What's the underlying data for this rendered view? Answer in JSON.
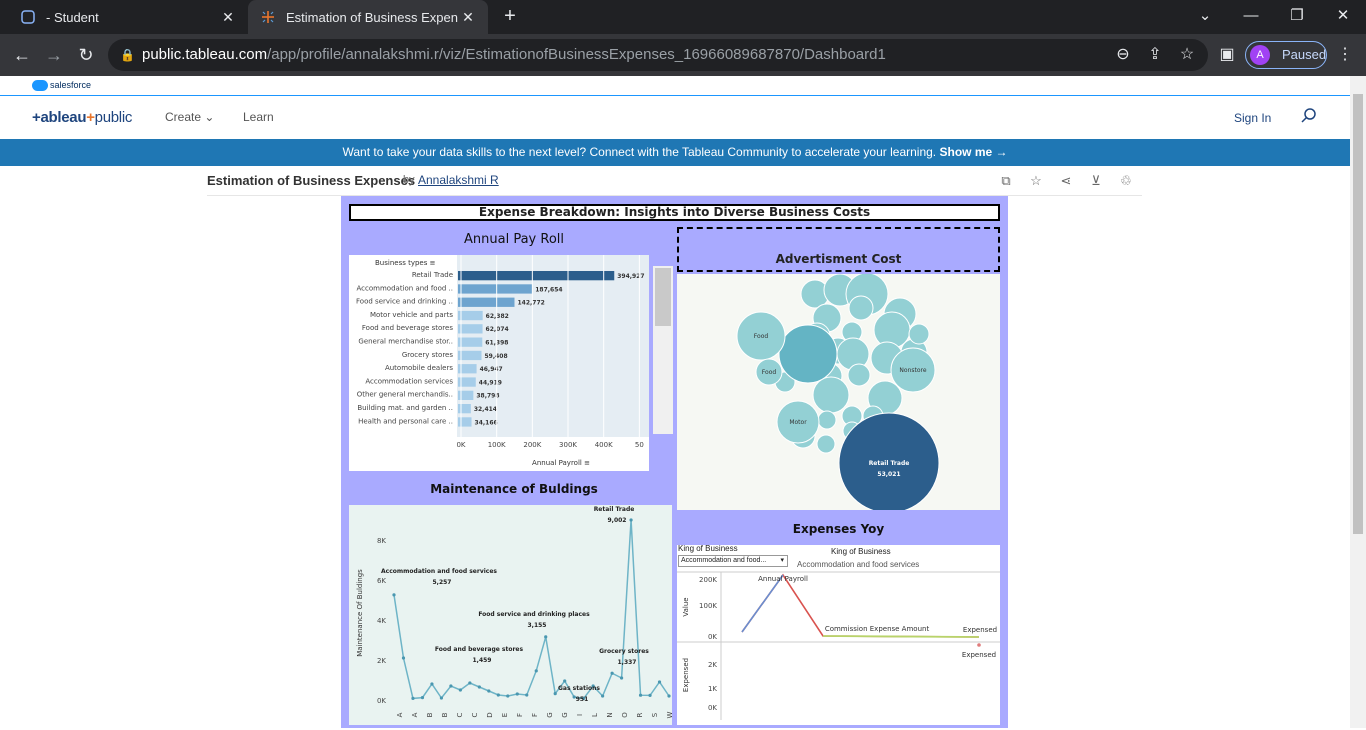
{
  "browser": {
    "tabs": [
      {
        "label": "- Student"
      },
      {
        "label": "Estimation of Business Expenses"
      }
    ],
    "url_host": "public.tableau.com",
    "url_path": "/app/profile/annalakshmi.r/viz/EstimationofBusinessExpenses_16966089687870/Dashboard1",
    "profile_initial": "A",
    "profile_label": "Paused"
  },
  "salesforce_label": "salesforce",
  "nav": {
    "logo_a": "+ableau",
    "logo_b": "+",
    "logo_c": "public",
    "create": "Create",
    "learn": "Learn",
    "signin": "Sign In"
  },
  "banner": {
    "text": "Want to take your data skills to the next level? Connect with the Tableau Community to accelerate your learning.",
    "cta": "Show me →"
  },
  "viz": {
    "title": "Estimation of Business Expenses",
    "by": "by",
    "author": "Annalakshmi R"
  },
  "dashboard": {
    "title": "Expense Breakdown: Insights into Diverse Business Costs",
    "payroll_title": "Annual Pay Roll",
    "ad_title": "Advertisment Cost",
    "maint_title": "Maintenance of Buldings",
    "yoy_title": "Expenses Yoy"
  },
  "chart_data": [
    {
      "type": "bar",
      "title": "Annual Pay Roll",
      "row_header": "Business types",
      "xlabel": "Annual Payroll",
      "xticks": [
        "0K",
        "100K",
        "200K",
        "300K",
        "400K",
        "50"
      ],
      "categories": [
        "Retail Trade",
        "Accommodation and food ..",
        "Food service and drinking ..",
        "Motor vehicle and parts",
        "Food and beverage stores",
        "General merchandise stor..",
        "Grocery stores",
        "Automobile dealers",
        "Accommodation services",
        "Other general merchandis..",
        "Building mat. and garden ..",
        "Health and personal care .."
      ],
      "values": [
        394927,
        187654,
        142772,
        62382,
        62074,
        61398,
        59408,
        46947,
        44919,
        38798,
        32414,
        34166
      ],
      "labels": [
        "394,927",
        "187,654",
        "142,772",
        "62,382",
        "62,074",
        "61,398",
        "59,408",
        "46,947",
        "44,919",
        "38,798",
        "32,414",
        "34,166"
      ],
      "xlim": [
        0,
        460000
      ]
    },
    {
      "type": "scatter",
      "title": "Advertisment Cost",
      "bubbles": [
        {
          "label": "Retail Trade",
          "value": "53,021"
        },
        {
          "label": "Food",
          "value": ""
        },
        {
          "label": "Food",
          "value": ""
        },
        {
          "label": "Nonstore",
          "value": ""
        },
        {
          "label": "Motor",
          "value": ""
        }
      ]
    },
    {
      "type": "line",
      "title": "Maintenance of Buldings",
      "ylabel": "Maintenance Of Buldings",
      "yticks": [
        "0K",
        "2K",
        "4K",
        "6K",
        "8K"
      ],
      "ylim": [
        0,
        9500
      ],
      "xticks": [
        "A",
        "A",
        "B",
        "B",
        "C",
        "C",
        "D",
        "E",
        "F",
        "F",
        "G",
        "G",
        "I",
        "L",
        "N",
        "O",
        "R",
        "S",
        "W"
      ],
      "values": [
        5257,
        2100,
        80,
        120,
        800,
        100,
        700,
        500,
        850,
        650,
        450,
        250,
        200,
        300,
        250,
        1459,
        3155,
        320,
        951,
        150,
        80,
        700,
        200,
        1337,
        1100,
        9002,
        240,
        230,
        900,
        200
      ],
      "annotations": [
        {
          "name": "Retail Trade",
          "value": "9,002"
        },
        {
          "name": "Accommodation and food services",
          "value": "5,257"
        },
        {
          "name": "Food service and drinking places",
          "value": "3,155"
        },
        {
          "name": "Food and beverage stores",
          "value": "1,459"
        },
        {
          "name": "Grocery stores",
          "value": "1,337"
        },
        {
          "name": "Gas stations",
          "value": "951"
        }
      ]
    },
    {
      "type": "line",
      "title": "Expenses Yoy",
      "filter_label": "King of Business",
      "filter_value": "Accommodation and food...",
      "subtitle_label": "King of Business",
      "subtitle_value": "Accommodation and food services",
      "top": {
        "ylabel": "Value",
        "yticks": [
          "0K",
          "100K",
          "200K"
        ],
        "labels": [
          "Annual Payroll",
          "Commission Expense Amount",
          "Expensed"
        ]
      },
      "bottom": {
        "ylabel": "Expensed",
        "yticks": [
          "0K",
          "1K",
          "2K"
        ],
        "labels": [
          "Expensed"
        ]
      }
    }
  ]
}
